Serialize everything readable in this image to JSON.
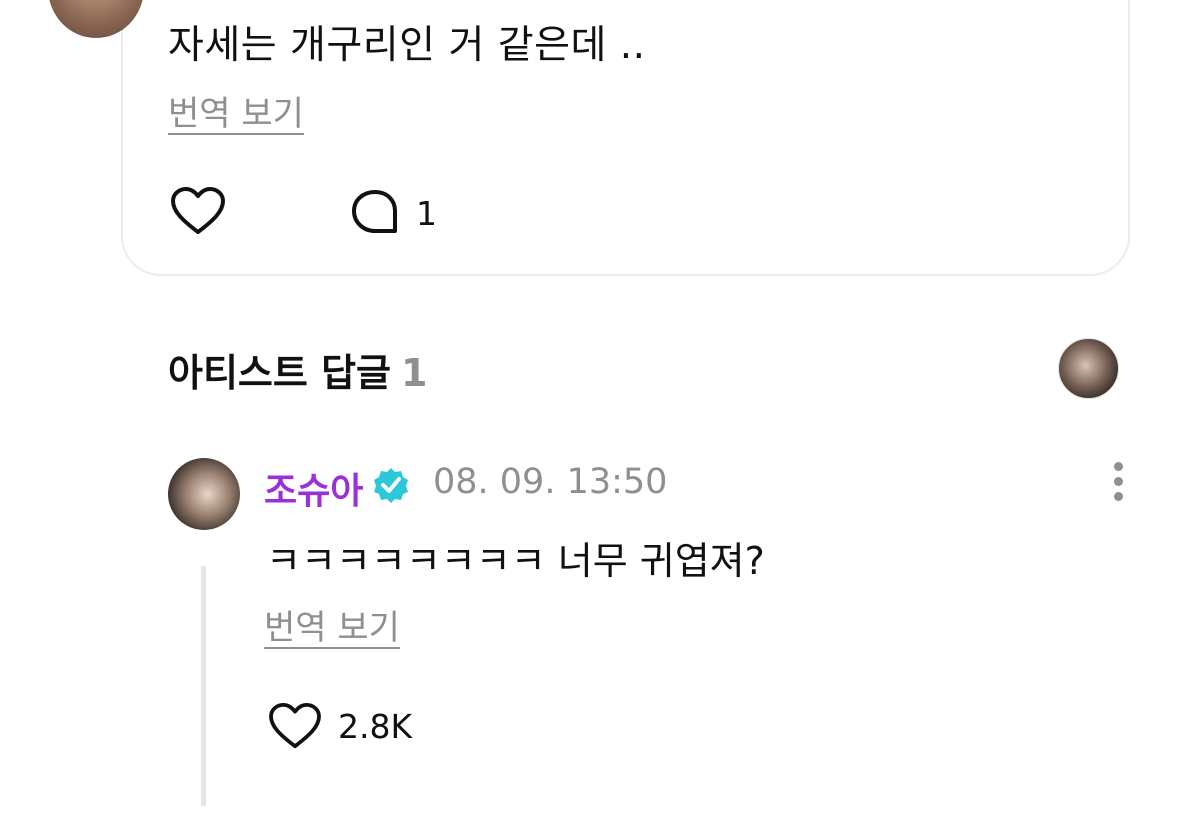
{
  "parent_comment": {
    "text": "자세는 개구리인 거 같은데 ..",
    "translate_label": "번역 보기",
    "reply_count": "1",
    "like_icon": "heart-outline-icon",
    "reply_icon": "speech-bubble-icon"
  },
  "artist_replies": {
    "title": "아티스트 답글",
    "count": "1"
  },
  "reply": {
    "author": "조슈아",
    "timestamp": "08. 09. 13:50",
    "text": "ㅋㅋㅋㅋㅋㅋㅋㅋ 너무 귀엽져?",
    "translate_label": "번역 보기",
    "like_count": "2.8K",
    "verified_color": "#2cc7d8",
    "author_color": "#9b30d9"
  }
}
